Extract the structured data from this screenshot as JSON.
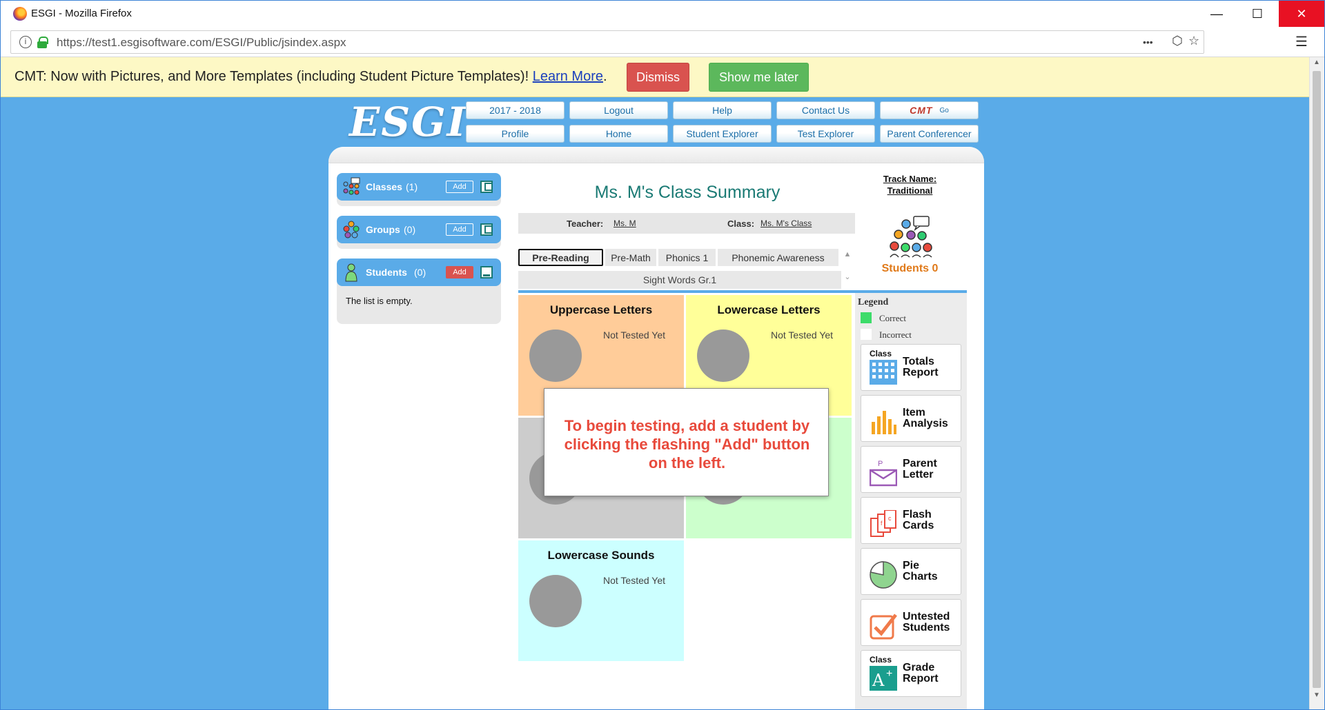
{
  "window": {
    "title": "ESGI - Mozilla Firefox",
    "minimize": "—",
    "maximize": "☐",
    "close": "✕"
  },
  "browser": {
    "url": "https://test1.esgisoftware.com/ESGI/Public/jsindex.aspx",
    "info_icon": "i",
    "more_icon": "•••",
    "pocket_icon": "⬡",
    "star_icon": "☆",
    "menu_icon": "☰"
  },
  "notice": {
    "text": "CMT: Now with Pictures, and More Templates (including Student Picture Templates)! ",
    "link": "Learn More",
    "period": ".",
    "dismiss": "Dismiss",
    "later": "Show me later"
  },
  "logo": "ESGI",
  "nav": {
    "row1": [
      "2017 - 2018",
      "Logout",
      "Help",
      "Contact Us"
    ],
    "cmt": {
      "label": "CMT",
      "go": "Go"
    },
    "row2": [
      "Profile",
      "Home",
      "Student Explorer",
      "Test Explorer",
      "Parent Conferencer"
    ]
  },
  "sidebar": {
    "classes": {
      "label": "Classes",
      "count": "(1)",
      "add": "Add"
    },
    "groups": {
      "label": "Groups",
      "count": "(0)",
      "add": "Add"
    },
    "students": {
      "label": "Students",
      "count": "(0)",
      "add": "Add",
      "empty": "The list is empty."
    }
  },
  "summary": {
    "title": "Ms. M's Class Summary",
    "teacher_label": "Teacher:",
    "teacher": "Ms. M",
    "class_label": "Class:",
    "class": "Ms. M's Class",
    "track_label": "Track Name:",
    "track": "Traditional",
    "students_count": "Students 0"
  },
  "tabs": {
    "row1": [
      "Pre-Reading",
      "Pre-Math",
      "Phonics 1",
      "Phonemic Awareness"
    ],
    "row2": "Sight Words Gr.1",
    "active": "Pre-Reading",
    "scroll_up": "▲",
    "scroll_down": "⌄"
  },
  "tiles": [
    {
      "title": "Uppercase Letters",
      "status": "Not Tested Yet",
      "color": "#ffcc99"
    },
    {
      "title": "Lowercase Letters",
      "status": "Not Tested Yet",
      "color": "#ffff99"
    },
    {
      "title": "",
      "status": "",
      "color": "#cccccc"
    },
    {
      "title": "",
      "status": "et",
      "color": "#ccffcc"
    },
    {
      "title": "Lowercase Sounds",
      "status": "Not Tested Yet",
      "color": "#ccffff"
    }
  ],
  "overlay": {
    "message": "To begin testing, add a student by clicking the flashing \"Add\" button on the left."
  },
  "legend": {
    "title": "Legend",
    "correct": "Correct",
    "incorrect": "Incorrect",
    "correct_color": "#3ddc6a",
    "incorrect_color": "#ffffff"
  },
  "reports": [
    {
      "prefix": "Class",
      "line1": "Totals",
      "line2": "Report",
      "icon": "grid-icon"
    },
    {
      "prefix": "",
      "line1": "Item",
      "line2": "Analysis",
      "icon": "bar-chart-icon"
    },
    {
      "prefix": "",
      "line1": "Parent",
      "line2": "Letter",
      "icon": "envelope-icon"
    },
    {
      "prefix": "",
      "line1": "Flash",
      "line2": "Cards",
      "icon": "cards-icon"
    },
    {
      "prefix": "",
      "line1": "Pie",
      "line2": "Charts",
      "icon": "pie-icon"
    },
    {
      "prefix": "",
      "line1": "Untested",
      "line2": "Students",
      "icon": "checkbox-icon"
    },
    {
      "prefix": "Class",
      "line1": "Grade",
      "line2": "Report",
      "icon": "grade-icon"
    }
  ],
  "colors": {
    "accent": "#5aabe8",
    "teal": "#1a7a74",
    "orange": "#e07a1a",
    "red": "#d9534f",
    "green": "#5cb85c"
  }
}
